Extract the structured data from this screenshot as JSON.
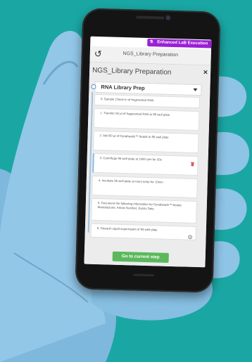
{
  "colors": {
    "background": "#1aa7a4",
    "glove": "#8ec4e6",
    "badge": "#9b1fd6",
    "primary_button": "#5cb85c",
    "rail": "#9fc3e0"
  },
  "app": {
    "mode_badge": "Enhanced LaB Execution",
    "topbar_title": "NGS_Library Preparation",
    "panel_title": "NGS_Library Preparation",
    "section_label": "RNA Library Prep",
    "primary_action": "Go to current step"
  },
  "steps": [
    {
      "label": "0. Sample Check-in of fragmented RNA",
      "active": false
    },
    {
      "label": "1. Transfer 50 µl of fragmented RNA to 96 well plate",
      "active": false
    },
    {
      "label": "2. Add 60 µl of Dynabeads™ Beads to 96 well plate",
      "active": false
    },
    {
      "label": "3. Centrifuge 96 well plate at 1000 rpm for 30s",
      "active": true
    },
    {
      "label": "4. Incubate 96 well plate at room temp for 10min",
      "active": false
    },
    {
      "label": "5. Document the following information for Dynabeads™ Beads: Manufacturer, Article Number, Expiry Date",
      "active": false
    },
    {
      "label": "6. Discard Liquid supernatant of 96 well plate",
      "active": false
    }
  ]
}
